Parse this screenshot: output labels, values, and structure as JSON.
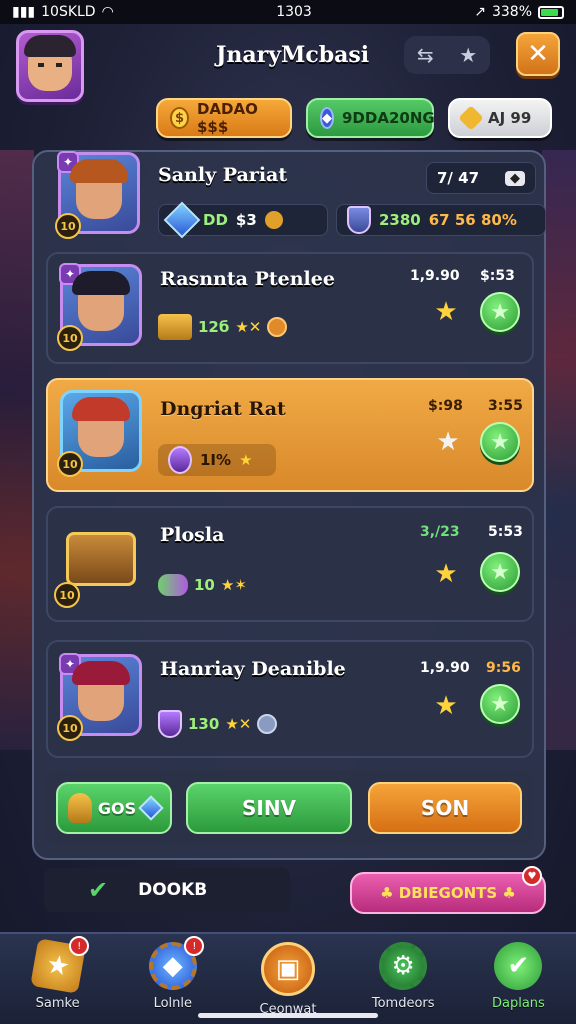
{
  "status": {
    "carrier": "10SKLD",
    "time": "1303",
    "battery": "338%"
  },
  "header": {
    "title": "JnaryMcbasi"
  },
  "currency": [
    {
      "label": "DADAO $$$"
    },
    {
      "label": "9DDA20NG"
    },
    {
      "label": "AJ 99"
    }
  ],
  "rows": [
    {
      "name": "Sanly Pariat",
      "level": "10",
      "info": "7/ 47",
      "stat_left": "DD",
      "stat_mid": "$3",
      "stat_right": "2380",
      "stat_pct": "67 56 80%"
    },
    {
      "name": "Rasnnta Ptenlee",
      "level": "10",
      "price": "1,9.90",
      "price2": "$:53",
      "stat": "12б"
    },
    {
      "name": "Dngriat Rat",
      "level": "10",
      "price": "$:98",
      "price2": "3:55",
      "stat": "1I%"
    },
    {
      "name": "Plosla",
      "level": "10",
      "price": "3,/23",
      "price2": "5:53",
      "stat": "10"
    },
    {
      "name": "Hanriay Deanible",
      "level": "10",
      "price": "1,9.90",
      "price2": "9:56",
      "stat": "130"
    }
  ],
  "actions": {
    "gos": "GOS",
    "sinv": "SINV",
    "son": "SON"
  },
  "footer": {
    "done": "DOOKB",
    "promo": "♣ DBIEGONTS ♣"
  },
  "nav": [
    {
      "label": "Samke"
    },
    {
      "label": "Lolnle"
    },
    {
      "label": "Ceonwat"
    },
    {
      "label": "Tomdeors"
    },
    {
      "label": "Daplans"
    }
  ],
  "colors": {
    "gold": "#f5a939",
    "green": "#5ad36a",
    "orange": "#f5a43a",
    "pink": "#ec5fb0",
    "panel": "#2c344c"
  }
}
